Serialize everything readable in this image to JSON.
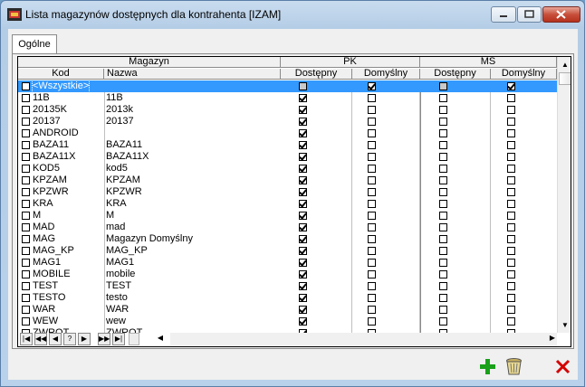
{
  "window": {
    "title": "Lista magazynów dostępnych dla kontrahenta [IZAM]"
  },
  "tabs": [
    {
      "label": "Ogólne"
    }
  ],
  "headers": {
    "group_magazyn": "Magazyn",
    "group_pk": "PK",
    "group_ms": "MS",
    "kod": "Kod",
    "nazwa": "Nazwa",
    "pk_dostepny": "Dostępny",
    "pk_domyslny": "Domyślny",
    "ms_dostepny": "Dostępny",
    "ms_domyslny": "Domyślny"
  },
  "rows": [
    {
      "kod": "<Wszystkie>",
      "nazwa": "",
      "pk_dost": "grey",
      "pk_dom": "on",
      "ms_dost": "grey",
      "ms_dom": "on",
      "selected": true
    },
    {
      "kod": "11B",
      "nazwa": "11B",
      "pk_dost": "on",
      "pk_dom": "off",
      "ms_dost": "off",
      "ms_dom": "off"
    },
    {
      "kod": "20135K",
      "nazwa": "2013k",
      "pk_dost": "on",
      "pk_dom": "off",
      "ms_dost": "off",
      "ms_dom": "off"
    },
    {
      "kod": "20137",
      "nazwa": "20137",
      "pk_dost": "on",
      "pk_dom": "off",
      "ms_dost": "off",
      "ms_dom": "off"
    },
    {
      "kod": "ANDROID",
      "nazwa": "",
      "pk_dost": "on",
      "pk_dom": "off",
      "ms_dost": "off",
      "ms_dom": "off"
    },
    {
      "kod": "BAZA11",
      "nazwa": "BAZA11",
      "pk_dost": "on",
      "pk_dom": "off",
      "ms_dost": "off",
      "ms_dom": "off"
    },
    {
      "kod": "BAZA11X",
      "nazwa": "BAZA11X",
      "pk_dost": "on",
      "pk_dom": "off",
      "ms_dost": "off",
      "ms_dom": "off"
    },
    {
      "kod": "KOD5",
      "nazwa": "kod5",
      "pk_dost": "on",
      "pk_dom": "off",
      "ms_dost": "off",
      "ms_dom": "off"
    },
    {
      "kod": "KPZAM",
      "nazwa": "KPZAM",
      "pk_dost": "on",
      "pk_dom": "off",
      "ms_dost": "off",
      "ms_dom": "off"
    },
    {
      "kod": "KPZWR",
      "nazwa": "KPZWR",
      "pk_dost": "on",
      "pk_dom": "off",
      "ms_dost": "off",
      "ms_dom": "off"
    },
    {
      "kod": "KRA",
      "nazwa": "KRA",
      "pk_dost": "on",
      "pk_dom": "off",
      "ms_dost": "off",
      "ms_dom": "off"
    },
    {
      "kod": "M",
      "nazwa": "M",
      "pk_dost": "on",
      "pk_dom": "off",
      "ms_dost": "off",
      "ms_dom": "off"
    },
    {
      "kod": "MAD",
      "nazwa": "mad",
      "pk_dost": "on",
      "pk_dom": "off",
      "ms_dost": "off",
      "ms_dom": "off"
    },
    {
      "kod": "MAG",
      "nazwa": "Magazyn Domyślny",
      "pk_dost": "on",
      "pk_dom": "off",
      "ms_dost": "off",
      "ms_dom": "off"
    },
    {
      "kod": "MAG_KP",
      "nazwa": "MAG_KP",
      "pk_dost": "on",
      "pk_dom": "off",
      "ms_dost": "off",
      "ms_dom": "off"
    },
    {
      "kod": "MAG1",
      "nazwa": "MAG1",
      "pk_dost": "on",
      "pk_dom": "off",
      "ms_dost": "off",
      "ms_dom": "off"
    },
    {
      "kod": "MOBILE",
      "nazwa": "mobile",
      "pk_dost": "on",
      "pk_dom": "off",
      "ms_dost": "off",
      "ms_dom": "off"
    },
    {
      "kod": "TEST",
      "nazwa": "TEST",
      "pk_dost": "on",
      "pk_dom": "off",
      "ms_dost": "off",
      "ms_dom": "off"
    },
    {
      "kod": "TESTO",
      "nazwa": "testo",
      "pk_dost": "on",
      "pk_dom": "off",
      "ms_dost": "off",
      "ms_dom": "off"
    },
    {
      "kod": "WAR",
      "nazwa": "WAR",
      "pk_dost": "on",
      "pk_dom": "off",
      "ms_dost": "off",
      "ms_dom": "off"
    },
    {
      "kod": "WEW",
      "nazwa": "wew",
      "pk_dost": "on",
      "pk_dom": "off",
      "ms_dost": "off",
      "ms_dom": "off"
    },
    {
      "kod": "ZWROT",
      "nazwa": "ZWROT",
      "pk_dost": "on",
      "pk_dom": "off",
      "ms_dost": "off",
      "ms_dom": "off"
    }
  ],
  "navigator": {
    "first": "|◀",
    "prev_page": "◀◀",
    "prev": "◀",
    "help": "?",
    "next": "▶",
    "next_page": "▶▶",
    "last": "▶|"
  },
  "icons": {
    "add": "plus-icon",
    "delete": "trash-icon",
    "close": "x-icon"
  },
  "colors": {
    "selection": "#3399ff",
    "add_green": "#1aa01a",
    "close_red": "#d40000"
  }
}
